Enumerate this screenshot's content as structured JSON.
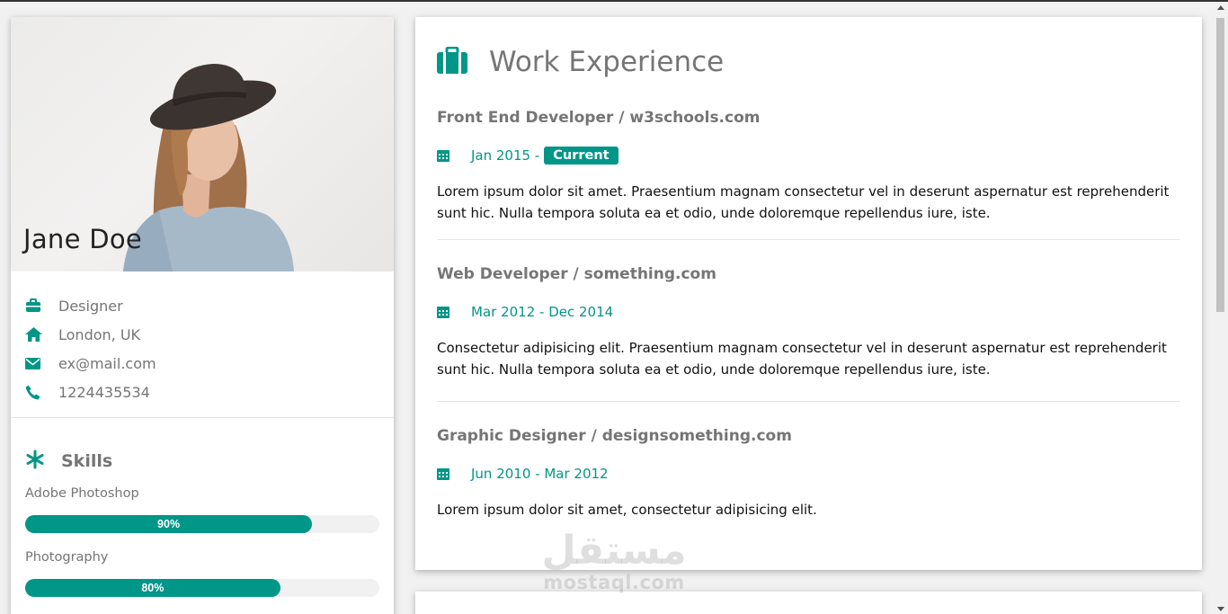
{
  "profile": {
    "name": "Jane Doe",
    "info": [
      {
        "icon": "briefcase-icon",
        "text": "Designer"
      },
      {
        "icon": "home-icon",
        "text": "London, UK"
      },
      {
        "icon": "envelope-icon",
        "text": "ex@mail.com"
      },
      {
        "icon": "phone-icon",
        "text": "1224435534"
      }
    ]
  },
  "skills": {
    "title": "Skills",
    "items": [
      {
        "name": "Adobe Photoshop",
        "percent": 90,
        "label": "90%"
      },
      {
        "name": "Photography",
        "percent": 80,
        "label": "80%"
      }
    ]
  },
  "experience": {
    "title": "Work Experience",
    "jobs": [
      {
        "title": "Front End Developer / w3schools.com",
        "date": "Jan 2015 -",
        "tag": "Current",
        "desc": "Lorem ipsum dolor sit amet. Praesentium magnam consectetur vel in deserunt aspernatur est reprehenderit sunt hic. Nulla tempora soluta ea et odio, unde doloremque repellendus iure, iste."
      },
      {
        "title": "Web Developer / something.com",
        "date": "Mar 2012 - Dec 2014",
        "tag": "",
        "desc": "Consectetur adipisicing elit. Praesentium magnam consectetur vel in deserunt aspernatur est reprehenderit sunt hic. Nulla tempora soluta ea et odio, unde doloremque repellendus iure, iste."
      },
      {
        "title": "Graphic Designer / designsomething.com",
        "date": "Jun 2010 - Mar 2012",
        "tag": "",
        "desc": "Lorem ipsum dolor sit amet, consectetur adipisicing elit."
      }
    ]
  },
  "watermark": {
    "arabic": "مستقل",
    "latin": "mostaql.com"
  },
  "colors": {
    "accent": "#009688",
    "muted": "#757575",
    "bar_bg": "#f1f1f1"
  }
}
